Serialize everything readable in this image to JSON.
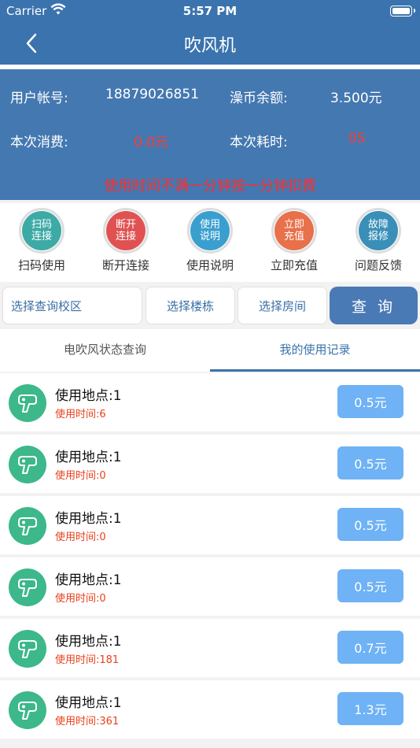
{
  "status_bar": {
    "carrier": "Carrier",
    "time": "5:57 PM"
  },
  "nav": {
    "title": "吹风机"
  },
  "info": {
    "account_label": "用户帐号:",
    "account_value": "18879026851",
    "balance_label": "澡币余额:",
    "balance_value": "3.500元",
    "cost_label": "本次消费:",
    "cost_value": "0.0元",
    "duration_label": "本次耗时:",
    "duration_value": "0S",
    "notice": "使用时间不满一分钟按一分钟扣费"
  },
  "actions": [
    {
      "icon_text": [
        "扫码",
        "连接"
      ],
      "label": "扫码使用",
      "color": "#3eaaa6"
    },
    {
      "icon_text": [
        "断开",
        "连接"
      ],
      "label": "断开连接",
      "color": "#e05252"
    },
    {
      "icon_text": [
        "使用",
        "说明"
      ],
      "label": "使用说明",
      "color": "#3a9fcf"
    },
    {
      "icon_text": [
        "立即",
        "充值"
      ],
      "label": "立即充值",
      "color": "#e8704a"
    },
    {
      "icon_text": [
        "故障",
        "报修"
      ],
      "label": "问题反馈",
      "color": "#3a8fb8"
    }
  ],
  "query": {
    "campus_placeholder": "选择查询校区",
    "building_placeholder": "选择楼栋",
    "room_placeholder": "选择房间",
    "button_label": "查 询"
  },
  "tabs": [
    {
      "label": "电吹风状态查询",
      "active": false
    },
    {
      "label": "我的使用记录",
      "active": true
    }
  ],
  "records": [
    {
      "place": "使用地点:1",
      "time": "使用时间:6",
      "price": "0.5元"
    },
    {
      "place": "使用地点:1",
      "time": "使用时间:0",
      "price": "0.5元"
    },
    {
      "place": "使用地点:1",
      "time": "使用时间:0",
      "price": "0.5元"
    },
    {
      "place": "使用地点:1",
      "time": "使用时间:0",
      "price": "0.5元"
    },
    {
      "place": "使用地点:1",
      "time": "使用时间:181",
      "price": "0.7元"
    },
    {
      "place": "使用地点:1",
      "time": "使用时间:361",
      "price": "1.3元"
    }
  ]
}
